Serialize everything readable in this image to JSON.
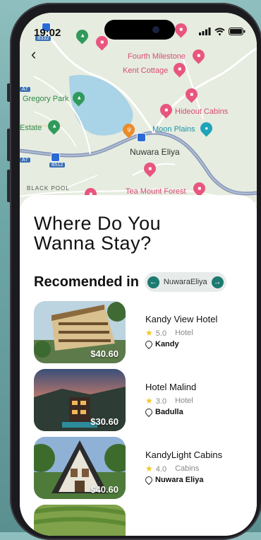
{
  "status": {
    "time": "19:02"
  },
  "map": {
    "labels": {
      "fourth_milestone": "Fourth Milestone",
      "kent_cottage": "Kent Cottage",
      "gregory_park": "Gregory Park",
      "hideout_cabins": "Hideout Cabins",
      "estate": "Estate",
      "moon_plains": "Moon Plains",
      "nuwara_eliya": "Nuwara Eliya",
      "black_pool": "BLACK POOL",
      "tea_mount_forest": "Tea Mount Forest",
      "road_b332": "B332",
      "road_b512": "B512",
      "road_a7": "A7"
    }
  },
  "headline": {
    "line1": "Where Do You",
    "line2": "Wanna Stay?"
  },
  "recommended": {
    "title": "Recomended in",
    "location": "NuwaraEliya"
  },
  "hotels": [
    {
      "name": "Kandy View Hotel",
      "rating": "5.0",
      "type": "Hotel",
      "city": "Kandy",
      "price": "$40.60"
    },
    {
      "name": "Hotel Malind",
      "rating": "3.0",
      "type": "Hotel",
      "city": "Badulla",
      "price": "$30.60"
    },
    {
      "name": "KandyLight Cabins",
      "rating": "4.0",
      "type": "Cabins",
      "city": "Nuwara Eliya",
      "price": "$40.60"
    }
  ],
  "colors": {
    "accent": "#1c7a6f",
    "pin": "#e8557e",
    "star": "#f3c623"
  },
  "icons": [
    "back-arrow-icon",
    "signal-icon",
    "wifi-icon",
    "battery-icon",
    "star-icon",
    "location-pin-icon",
    "arrow-left-icon",
    "arrow-right-icon"
  ]
}
